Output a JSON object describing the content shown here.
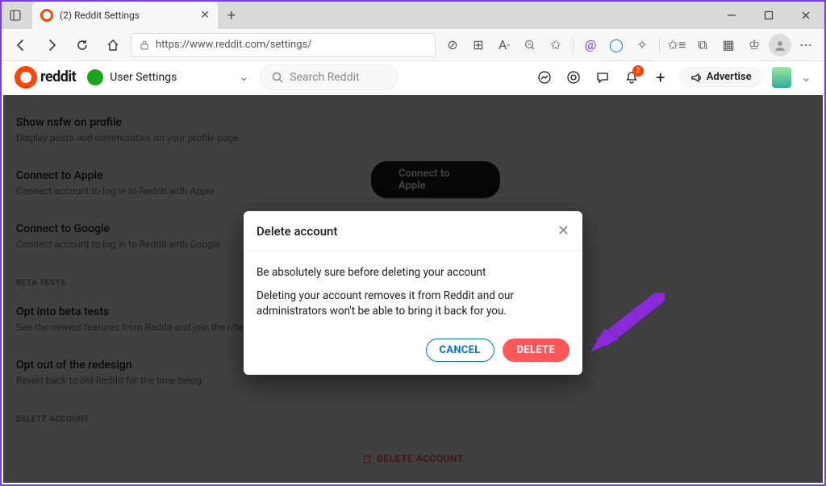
{
  "browser": {
    "tab_title": "(2) Reddit Settings",
    "url": "https://www.reddit.com/settings/"
  },
  "reddit_header": {
    "logo_word": "reddit",
    "nav_label": "User Settings",
    "search_placeholder": "Search Reddit",
    "advertise_label": "Advertise",
    "notification_count": "2"
  },
  "settings": {
    "row0_title": "Show nsfw on profile",
    "row0_desc": "Display posts and communities on your profile page",
    "apple_title": "Connect to Apple",
    "apple_desc": "Connect account to log in to Reddit with Apple",
    "apple_btn": "Connect to Apple",
    "google_title": "Connect to Google",
    "google_desc": "Connect account to log in to Reddit with Google",
    "beta_section": "BETA TESTS",
    "beta_opt_title": "Opt into beta tests",
    "beta_opt_desc": "See the newest features from Reddit and join the r/beta community",
    "redesign_title": "Opt out of the redesign",
    "redesign_desc": "Revert back to old Reddit for the time being",
    "delete_section": "DELETE ACCOUNT",
    "delete_link": "DELETE ACCOUNT"
  },
  "modal": {
    "title": "Delete account",
    "warn": "Be absolutely sure before deleting your account",
    "text": "Deleting your account removes it from Reddit and our administrators won't be able to bring it back for you.",
    "cancel": "CANCEL",
    "delete": "DELETE"
  }
}
